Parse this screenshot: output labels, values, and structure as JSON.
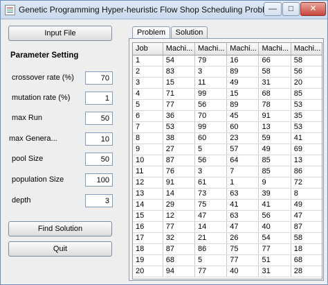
{
  "window": {
    "title": "Genetic Programming Hyper-heuristic Flow Shop Scheduling Problems",
    "minimize": "—",
    "maximize": "□",
    "close": "✕"
  },
  "left": {
    "input_file": "Input File",
    "section_title": "Parameter Setting",
    "params": [
      {
        "label": "crossover rate (%)",
        "value": "70"
      },
      {
        "label": "mutation rate (%)",
        "value": "1"
      },
      {
        "label": "max Run",
        "value": "50"
      },
      {
        "label": "max Genera...",
        "value": "10"
      },
      {
        "label": "pool Size",
        "value": "50"
      },
      {
        "label": "population Size",
        "value": "100"
      },
      {
        "label": "depth",
        "value": "3"
      }
    ],
    "find_solution": "Find Solution",
    "quit": "Quit"
  },
  "tabs": [
    {
      "label": "Problem",
      "selected": true
    },
    {
      "label": "Solution",
      "selected": false
    }
  ],
  "table": {
    "headers": [
      "Job",
      "Machi...",
      "Machi...",
      "Machi...",
      "Machi...",
      "Machi..."
    ],
    "rows": [
      [
        "1",
        "54",
        "79",
        "16",
        "66",
        "58"
      ],
      [
        "2",
        "83",
        "3",
        "89",
        "58",
        "56"
      ],
      [
        "3",
        "15",
        "11",
        "49",
        "31",
        "20"
      ],
      [
        "4",
        "71",
        "99",
        "15",
        "68",
        "85"
      ],
      [
        "5",
        "77",
        "56",
        "89",
        "78",
        "53"
      ],
      [
        "6",
        "36",
        "70",
        "45",
        "91",
        "35"
      ],
      [
        "7",
        "53",
        "99",
        "60",
        "13",
        "53"
      ],
      [
        "8",
        "38",
        "60",
        "23",
        "59",
        "41"
      ],
      [
        "9",
        "27",
        "5",
        "57",
        "49",
        "69"
      ],
      [
        "10",
        "87",
        "56",
        "64",
        "85",
        "13"
      ],
      [
        "11",
        "76",
        "3",
        "7",
        "85",
        "86"
      ],
      [
        "12",
        "91",
        "61",
        "1",
        "9",
        "72"
      ],
      [
        "13",
        "14",
        "73",
        "63",
        "39",
        "8"
      ],
      [
        "14",
        "29",
        "75",
        "41",
        "41",
        "49"
      ],
      [
        "15",
        "12",
        "47",
        "63",
        "56",
        "47"
      ],
      [
        "16",
        "77",
        "14",
        "47",
        "40",
        "87"
      ],
      [
        "17",
        "32",
        "21",
        "26",
        "54",
        "58"
      ],
      [
        "18",
        "87",
        "86",
        "75",
        "77",
        "18"
      ],
      [
        "19",
        "68",
        "5",
        "77",
        "51",
        "68"
      ],
      [
        "20",
        "94",
        "77",
        "40",
        "31",
        "28"
      ]
    ]
  }
}
